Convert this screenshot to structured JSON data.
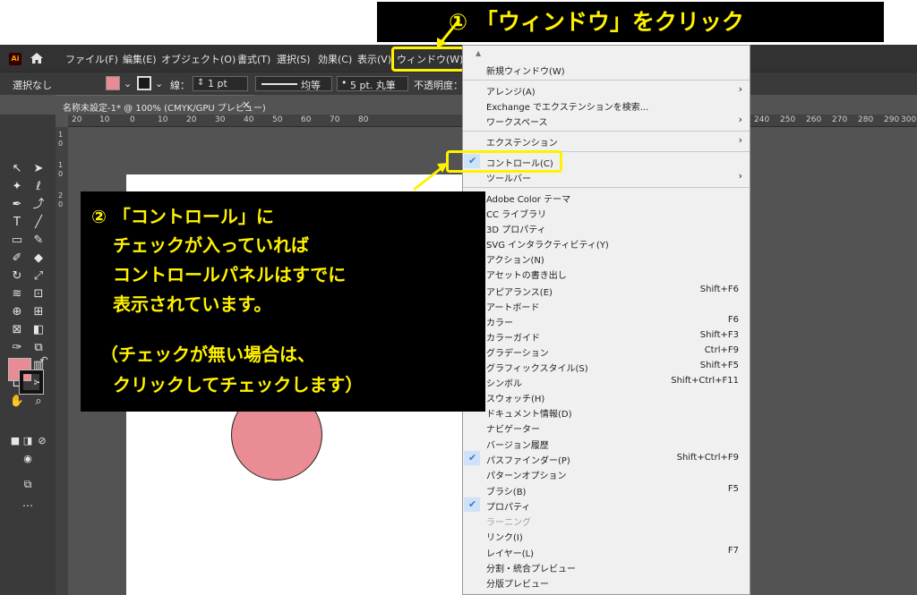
{
  "callouts": {
    "step1": "① 「ウィンドウ」をクリック",
    "step2_lines": [
      "② 「コントロール」に",
      "チェックが入っていれば",
      "コントロールパネルはすでに",
      "表示されています。",
      "（チェックが無い場合は、",
      "クリックしてチェックします）"
    ]
  },
  "app": {
    "logo": "Ai",
    "menu": [
      "ファイル(F)",
      "編集(E)",
      "オブジェクト(O)",
      "書式(T)",
      "選択(S)",
      "効果(C)",
      "表示(V)",
      "ウィンドウ(W)"
    ]
  },
  "control_bar": {
    "selection": "選択なし",
    "stroke_label": "線：",
    "stroke_value": "1 pt",
    "line_style": "均等",
    "brush": "5 pt. 丸筆",
    "opacity_label": "不透明度："
  },
  "document_tab": {
    "title": "名称未設定-1* @ 100% (CMYK/GPU プレビュー)",
    "close": "×"
  },
  "ruler": {
    "top": [
      "20",
      "10",
      "0",
      "10",
      "20",
      "30",
      "40",
      "50",
      "60",
      "70",
      "80",
      "240",
      "250",
      "260",
      "270",
      "280",
      "290",
      "300"
    ],
    "left": [
      "1",
      "0",
      "1",
      "0",
      "2",
      "0"
    ]
  },
  "window_menu": [
    {
      "label": "新規ウィンドウ(W)"
    },
    {
      "label": "アレンジ(A)",
      "submenu": true
    },
    {
      "label": "Exchange でエクステンションを検索..."
    },
    {
      "label": "ワークスペース",
      "submenu": true
    },
    {
      "label": "エクステンション",
      "submenu": true
    },
    {
      "label": "コントロール(C)",
      "checked": true
    },
    {
      "label": "ツールバー",
      "submenu": true
    },
    {
      "label": "Adobe Color テーマ"
    },
    {
      "label": "CC ライブラリ"
    },
    {
      "label": "3D プロパティ"
    },
    {
      "label": "SVG インタラクティビティ(Y)"
    },
    {
      "label": "アクション(N)"
    },
    {
      "label": "アセットの書き出し"
    },
    {
      "label": "アピアランス(E)",
      "shortcut": "Shift+F6"
    },
    {
      "label": "アートボード"
    },
    {
      "label": "カラー",
      "shortcut": "F6"
    },
    {
      "label": "カラーガイド",
      "shortcut": "Shift+F3"
    },
    {
      "label": "グラデーション",
      "shortcut": "Ctrl+F9"
    },
    {
      "label": "グラフィックスタイル(S)",
      "shortcut": "Shift+F5"
    },
    {
      "label": "シンボル",
      "shortcut": "Shift+Ctrl+F11"
    },
    {
      "label": "スウォッチ(H)"
    },
    {
      "label": "ドキュメント情報(D)"
    },
    {
      "label": "ナビゲーター"
    },
    {
      "label": "バージョン履歴"
    },
    {
      "label": "パスファインダー(P)",
      "shortcut": "Shift+Ctrl+F9",
      "checked": true
    },
    {
      "label": "パターンオプション"
    },
    {
      "label": "ブラシ(B)",
      "shortcut": "F5"
    },
    {
      "label": "プロパティ",
      "checked": true
    },
    {
      "label": "ラーニング",
      "disabled": true
    },
    {
      "label": "リンク(I)"
    },
    {
      "label": "レイヤー(L)",
      "shortcut": "F7"
    },
    {
      "label": "分割・統合プレビュー"
    },
    {
      "label": "分版プレビュー"
    }
  ],
  "colors": {
    "callout_bg": "#000000",
    "callout_text": "#fff200",
    "highlight": "#fff200",
    "fill_swatch": "#e88b95",
    "check": "#3a7bd5"
  }
}
